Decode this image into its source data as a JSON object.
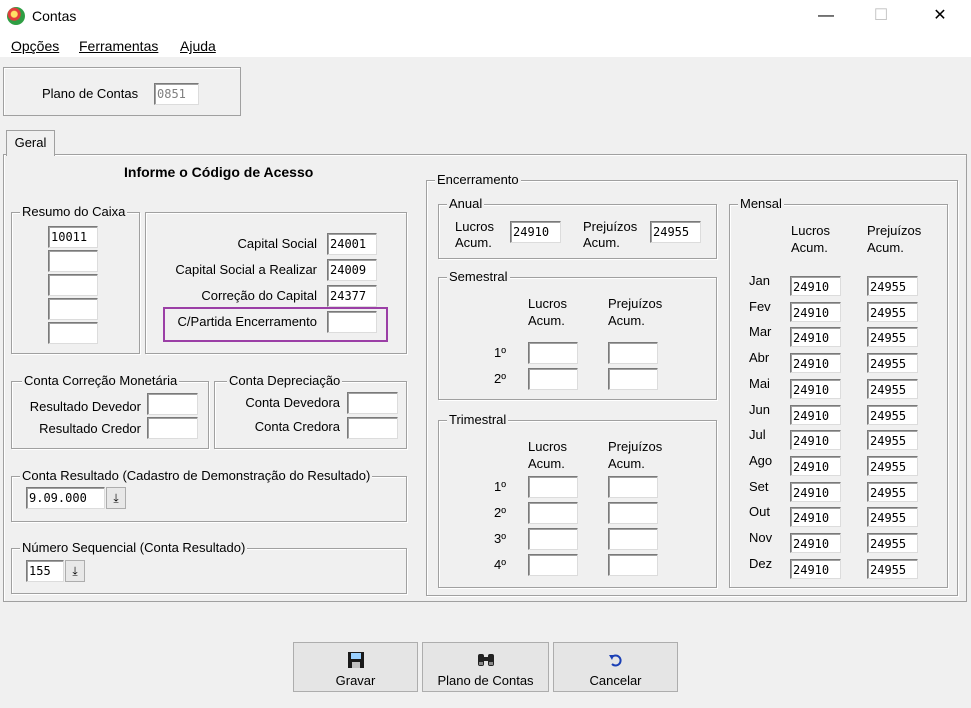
{
  "window": {
    "title": "Contas",
    "minimize": "—",
    "maximize": "☐",
    "close": "✕"
  },
  "menu": {
    "opcoes": "Opções",
    "ferramentas": "Ferramentas",
    "ajuda": "Ajuda"
  },
  "plano": {
    "label": "Plano de Contas",
    "value": "0851"
  },
  "tab": {
    "label": "Geral"
  },
  "header": "Informe o Código de Acesso",
  "resumo": {
    "legend": "Resumo do Caixa",
    "values": [
      "10011",
      "",
      "",
      "",
      ""
    ]
  },
  "capital": {
    "rows": [
      {
        "label": "Capital Social",
        "value": "24001"
      },
      {
        "label": "Capital Social a Realizar",
        "value": "24009"
      },
      {
        "label": "Correção do Capital",
        "value": "24377"
      },
      {
        "label": "C/Partida Encerramento",
        "value": ""
      }
    ]
  },
  "correcao": {
    "legend": "Conta Correção Monetária",
    "devedor": "Resultado Devedor",
    "credor": "Resultado Credor"
  },
  "depreciacao": {
    "legend": "Conta Depreciação",
    "devedora": "Conta Devedora",
    "credora": "Conta Credora"
  },
  "resultado": {
    "legend": "Conta Resultado (Cadastro de Demonstração do Resultado)",
    "value": "9.09.000"
  },
  "sequencial": {
    "legend": "Número Sequencial (Conta Resultado)",
    "value": "155"
  },
  "encerramento": {
    "legend": "Encerramento",
    "anual": {
      "legend": "Anual",
      "lucros": "Lucros Acum.",
      "lucros_l1": "Lucros",
      "lucros_l2": "Acum.",
      "prejuizos_l1": "Prejuízos",
      "prejuizos_l2": "Acum.",
      "lucros_value": "24910",
      "prejuizos_value": "24955"
    },
    "semestral": {
      "legend": "Semestral",
      "lucros_l1": "Lucros",
      "lucros_l2": "Acum.",
      "prejuizos_l1": "Prejuízos",
      "prejuizos_l2": "Acum.",
      "rows": [
        "1º",
        "2º"
      ]
    },
    "trimestral": {
      "legend": "Trimestral",
      "lucros_l1": "Lucros",
      "lucros_l2": "Acum.",
      "prejuizos_l1": "Prejuízos",
      "prejuizos_l2": "Acum.",
      "rows": [
        "1º",
        "2º",
        "3º",
        "4º"
      ]
    },
    "mensal": {
      "legend": "Mensal",
      "lucros_l1": "Lucros",
      "lucros_l2": "Acum.",
      "prejuizos_l1": "Prejuízos",
      "prejuizos_l2": "Acum.",
      "months": [
        "Jan",
        "Fev",
        "Mar",
        "Abr",
        "Mai",
        "Jun",
        "Jul",
        "Ago",
        "Set",
        "Out",
        "Nov",
        "Dez"
      ],
      "lucros_value": "24910",
      "prejuizos_value": "24955"
    }
  },
  "buttons": {
    "gravar": "Gravar",
    "plano": "Plano de Contas",
    "cancelar": "Cancelar"
  }
}
